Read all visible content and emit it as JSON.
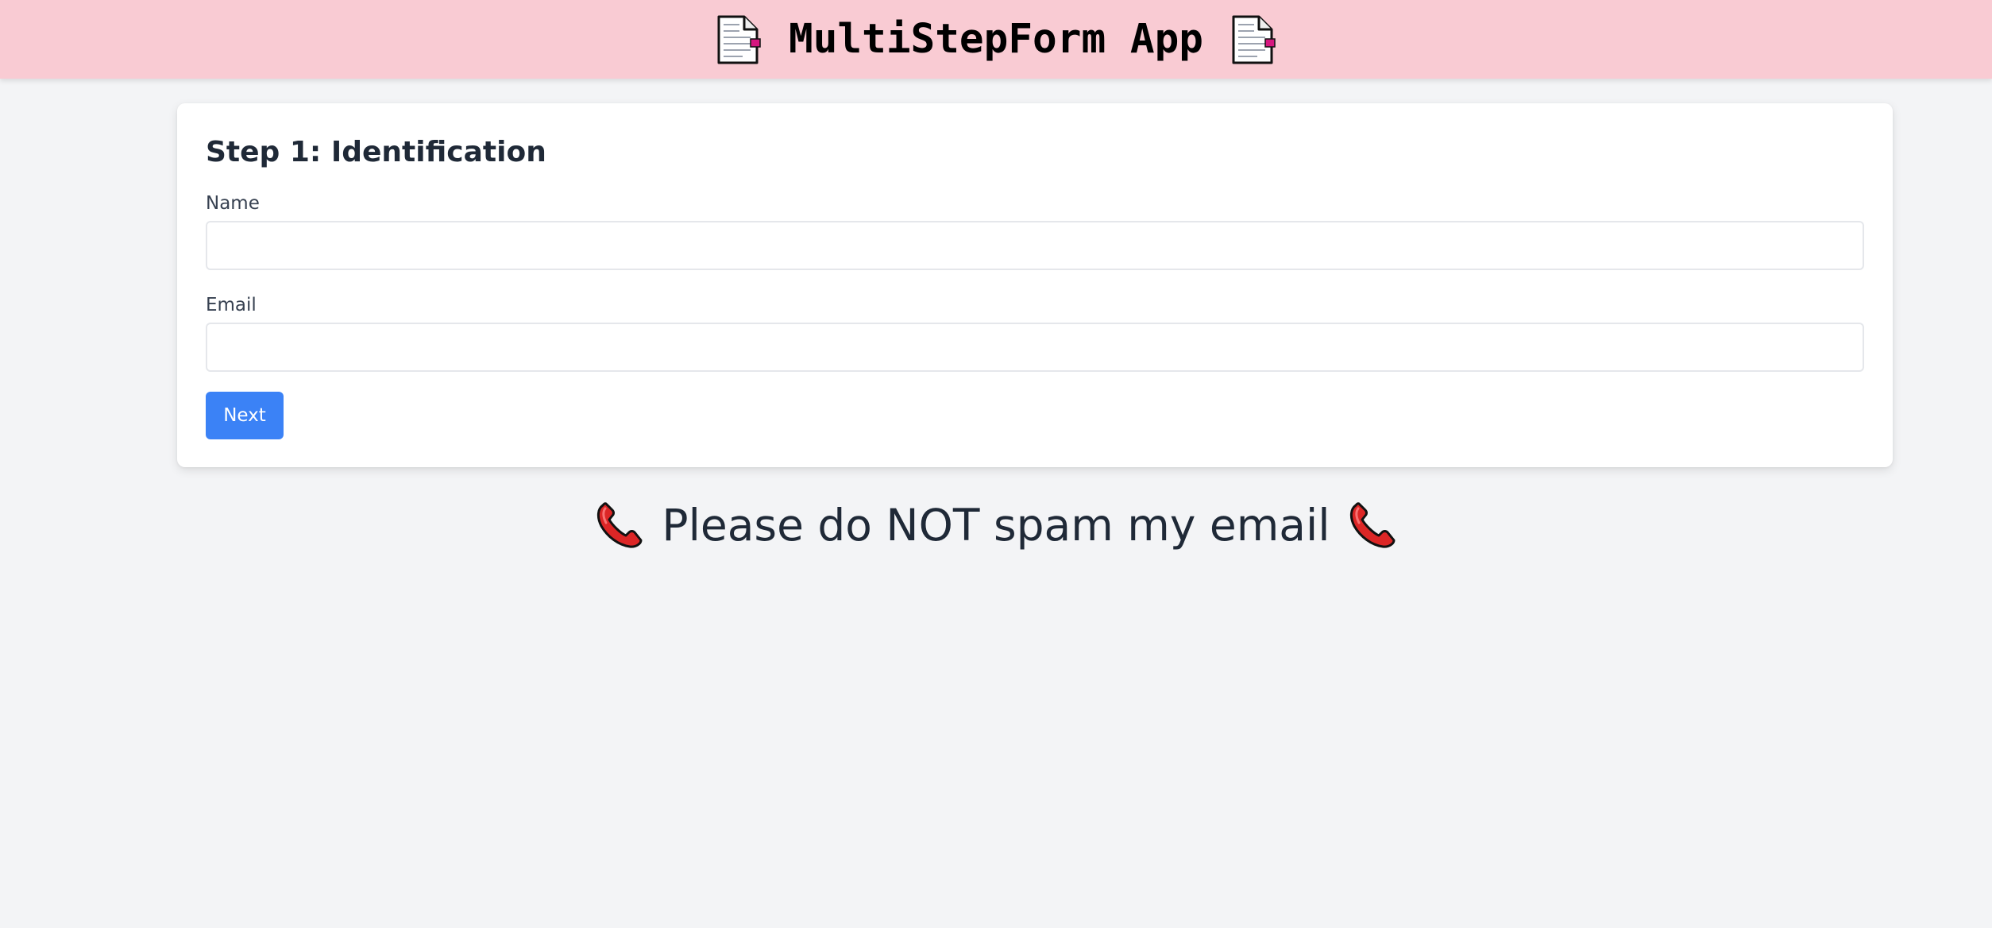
{
  "header": {
    "title": "MultiStepForm App",
    "left_icon": "document-icon",
    "right_icon": "document-icon",
    "background_color": "#f9cbd3"
  },
  "form": {
    "step_title": "Step 1: Identification",
    "fields": [
      {
        "label": "Name",
        "value": "",
        "placeholder": ""
      },
      {
        "label": "Email",
        "value": "",
        "placeholder": ""
      }
    ],
    "next_label": "Next",
    "accent_color": "#3b82f6"
  },
  "notice": {
    "text": "Please do NOT spam my email",
    "left_icon": "telephone-receiver-icon",
    "right_icon": "telephone-receiver-icon"
  }
}
